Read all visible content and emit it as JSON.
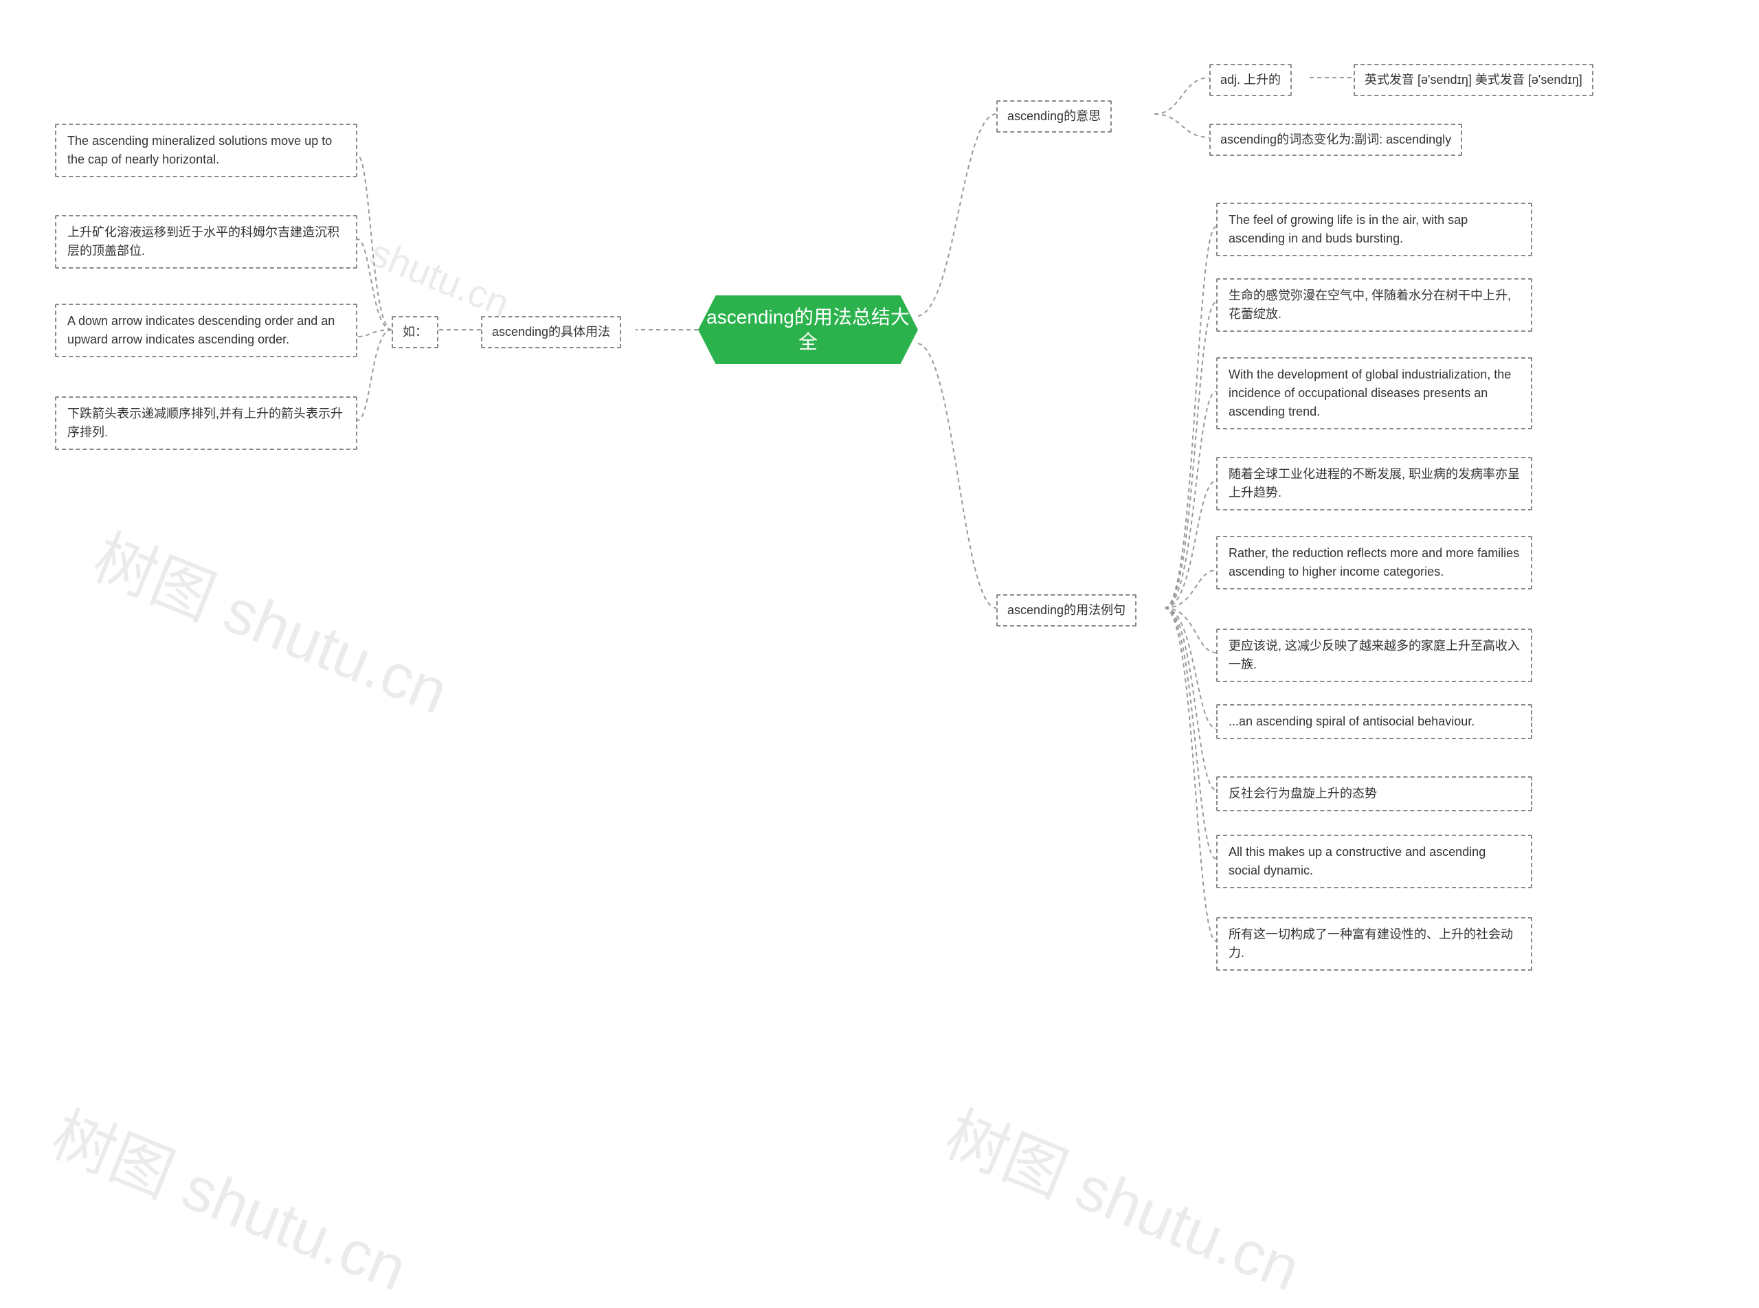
{
  "root": {
    "title": "ascending的用法总结大全"
  },
  "left": {
    "branch": "ascending的具体用法",
    "sub": "如：",
    "items": [
      "The ascending mineralized solutions move up to the cap of nearly horizontal.",
      "上升矿化溶液运移到近于水平的科姆尔吉建造沉积层的顶盖部位.",
      "A down arrow indicates descending order and an upward arrow indicates ascending order.",
      "下跌箭头表示递减顺序排列,并有上升的箭头表示升序排列."
    ]
  },
  "right": {
    "meaning": {
      "label": "ascending的意思",
      "adj": "adj. 上升的",
      "pron": "英式发音 [ə'sendɪŋ] 美式发音 [ə'sendɪŋ]",
      "morph": "ascending的词态变化为:副词: ascendingly"
    },
    "examples": {
      "label": "ascending的用法例句",
      "items": [
        "The feel of growing life is in the air, with sap ascending in and buds bursting.",
        "生命的感觉弥漫在空气中, 伴随着水分在树干中上升,花蕾绽放.",
        "With the development of global industrialization, the incidence of occupational diseases presents an ascending trend.",
        "随着全球工业化进程的不断发展, 职业病的发病率亦呈上升趋势.",
        "Rather, the reduction reflects more and more families ascending to higher income categories.",
        "更应该说, 这减少反映了越来越多的家庭上升至高收入一族.",
        "...an ascending spiral of antisocial behaviour.",
        "反社会行为盘旋上升的态势",
        "All this makes up a constructive and ascending social dynamic.",
        "所有这一切构成了一种富有建设性的、上升的社会动力."
      ]
    }
  },
  "watermarks": [
    "shutu.cn",
    "树图 shutu.cn",
    "树图 shutu.cn",
    "树图 shutu.cn"
  ]
}
